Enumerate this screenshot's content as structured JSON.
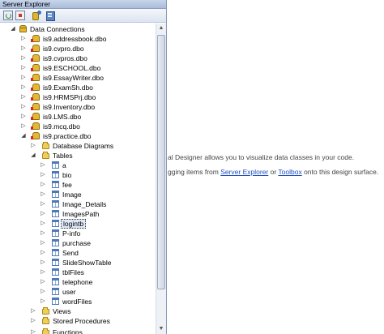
{
  "panel": {
    "title": "Server Explorer"
  },
  "toolbar": {
    "refresh_icon": "refresh-icon",
    "stop_icon": "stop-refresh-icon",
    "connect_icon": "connect-to-database-icon",
    "server_icon": "connect-to-server-icon"
  },
  "tree": {
    "data_connections": "Data Connections",
    "dbs": [
      "is9.addressbook.dbo",
      "is9.cvpro.dbo",
      "is9.cvpros.dbo",
      "is9.ESCHOOL.dbo",
      "is9.EssayWriter.dbo",
      "is9.ExamSh.dbo",
      "is9.HRMSPrj.dbo",
      "is9.Inventory.dbo",
      "is9.LMS.dbo",
      "is9.mcq.dbo",
      "is9.practice.dbo"
    ],
    "database_diagrams": "Database Diagrams",
    "tables": "Tables",
    "table_items": [
      "a",
      "bio",
      "fee",
      "Image",
      "Image_Details",
      "ImagesPath",
      "logintb",
      "P-info",
      "purchase",
      "Send",
      "SlideShowTable",
      "tblFiles",
      "telephone",
      "user",
      "wordFiles"
    ],
    "selected_table": "logintb",
    "views": "Views",
    "stored_procedures": "Stored Procedures",
    "functions": "Functions"
  },
  "designer": {
    "line1": "al Designer allows you to visualize data classes in your code.",
    "line2_pre": "gging items from ",
    "line2_link1": "Server Explorer",
    "line2_mid": " or ",
    "line2_link2": "Toolbox",
    "line2_post": " onto this design surface."
  },
  "colors": {
    "accent": "#1f4fbf",
    "title_bar": "#b7c8e4",
    "selection": "#dfe9f7"
  }
}
